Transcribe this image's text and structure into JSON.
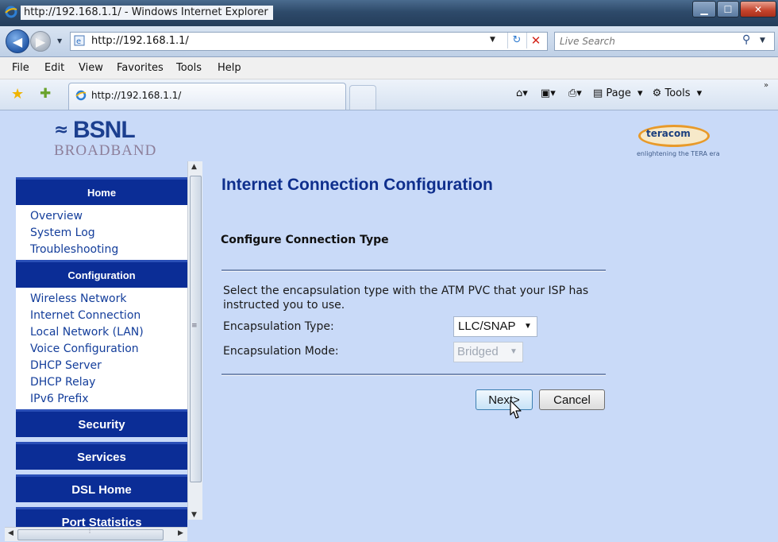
{
  "window": {
    "title": "http://192.168.1.1/ - Windows Internet Explorer"
  },
  "address_bar": {
    "url": "http://192.168.1.1/",
    "search_placeholder": "Live Search"
  },
  "menu": {
    "items": [
      "File",
      "Edit",
      "View",
      "Favorites",
      "Tools",
      "Help"
    ]
  },
  "command_bar": {
    "tab_title": "http://192.168.1.1/",
    "page_label": "Page",
    "tools_label": "Tools"
  },
  "header": {
    "brand": "BSNL",
    "brand_sub": "BROADBAND",
    "partner": "teracom",
    "partner_tagline": "enlightening the TERA era"
  },
  "sidebar": {
    "sections": [
      {
        "title": "Home",
        "links": [
          "Overview",
          "System Log",
          "Troubleshooting"
        ]
      },
      {
        "title": "Configuration",
        "links": [
          "Wireless Network",
          "Internet Connection",
          "Local Network (LAN)",
          "Voice Configuration",
          "DHCP Server",
          "DHCP Relay",
          "IPv6 Prefix"
        ]
      },
      {
        "title": "Security",
        "links": []
      },
      {
        "title": "Services",
        "links": []
      },
      {
        "title": "DSL Home",
        "links": []
      },
      {
        "title": "Port Statistics",
        "links": []
      }
    ]
  },
  "main": {
    "title": "Internet Connection Configuration",
    "subtitle": "Configure Connection Type",
    "description": "Select the encapsulation type with the ATM PVC that your ISP has instructed you to use.",
    "encapsulation_type_label": "Encapsulation Type:",
    "encapsulation_type_value": "LLC/SNAP",
    "encapsulation_mode_label": "Encapsulation Mode:",
    "encapsulation_mode_value": "Bridged",
    "next_label": "Next>",
    "cancel_label": "Cancel"
  },
  "colors": {
    "page_bg": "#c9daf8",
    "nav_header": "#0b2d96",
    "link": "#143e9b",
    "title": "#0f2f8d"
  }
}
